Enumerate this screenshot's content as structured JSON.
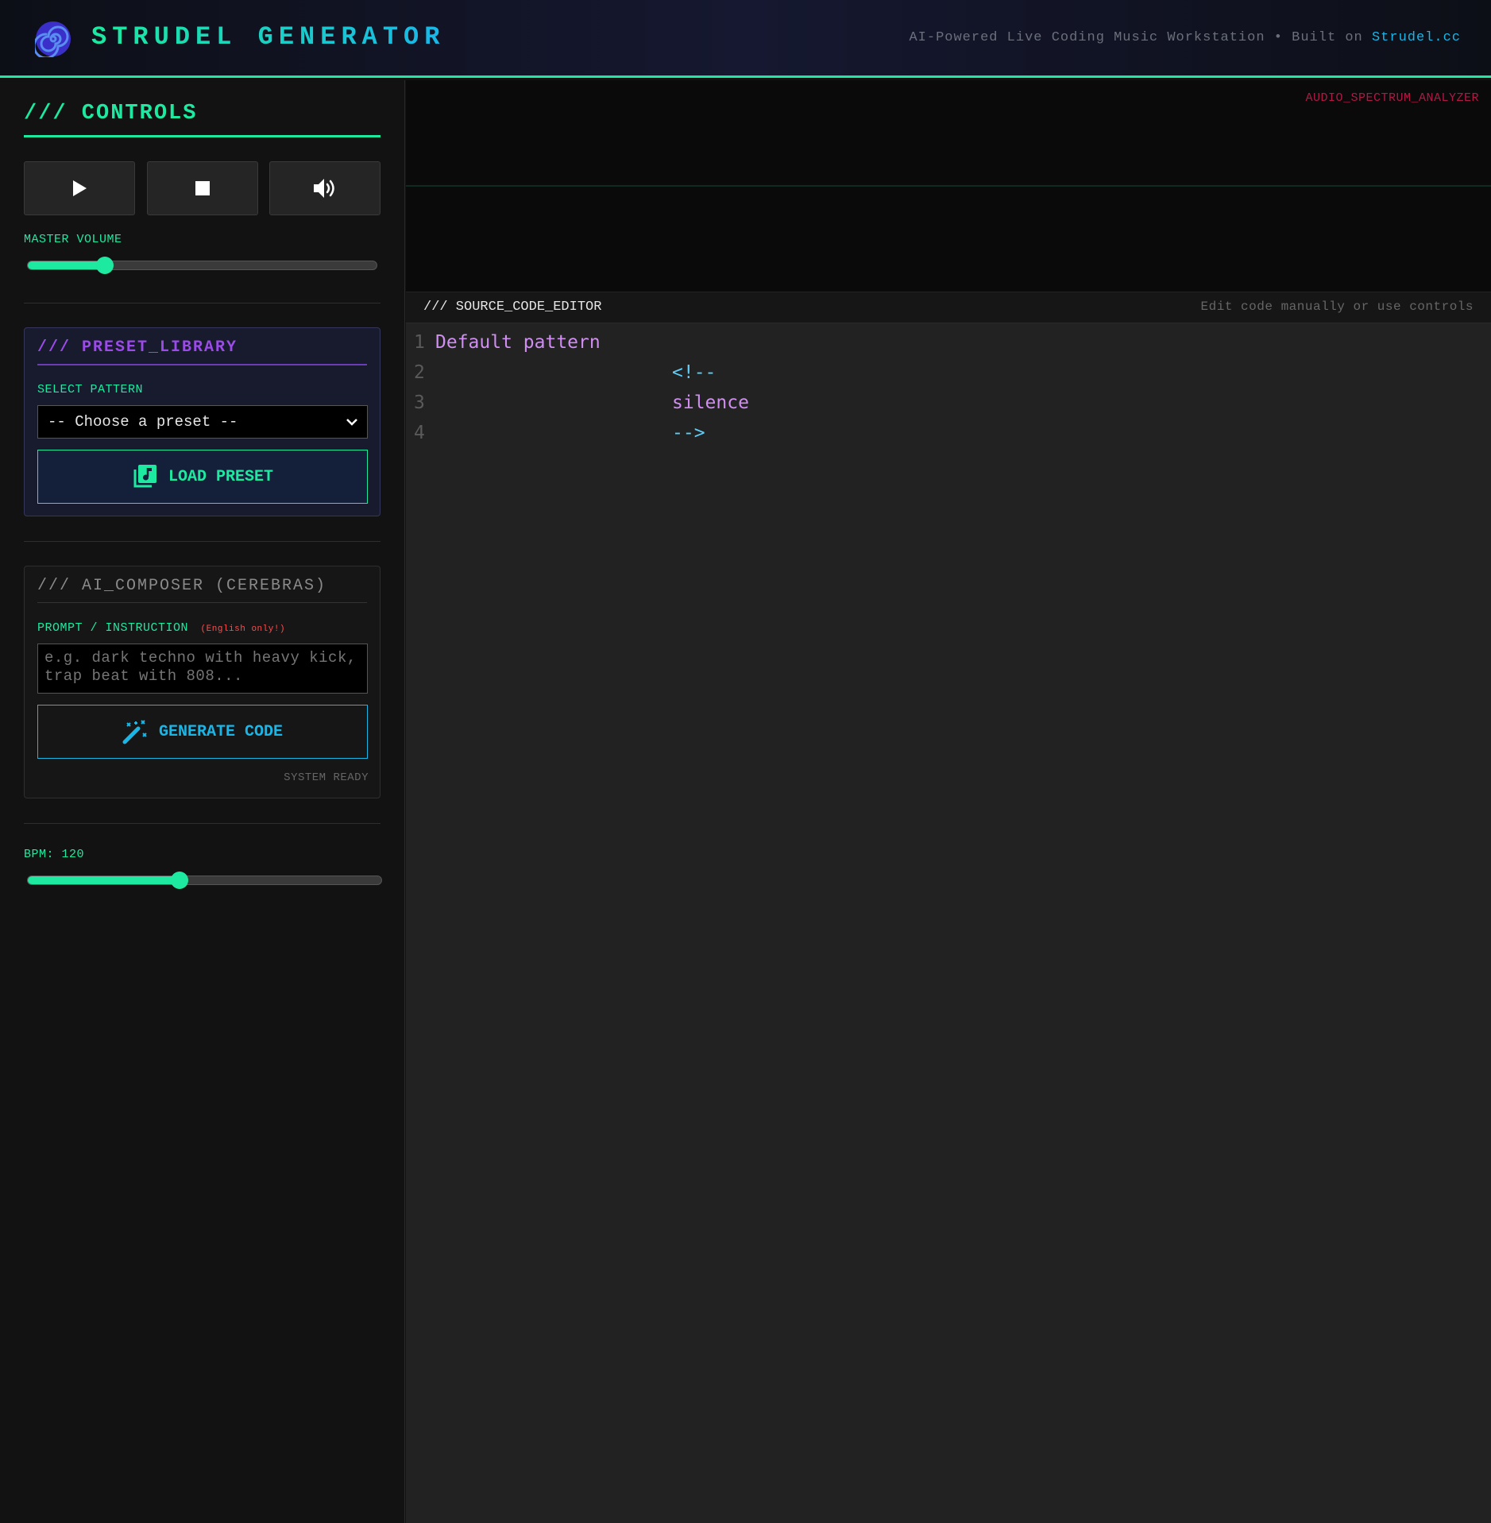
{
  "header": {
    "title": "STRUDEL GENERATOR",
    "tagline_prefix": "AI-Powered Live Coding Music Workstation • Built on ",
    "tagline_link": "Strudel.cc"
  },
  "controls": {
    "section_title": "/// CONTROLS",
    "volume_label": "MASTER VOLUME",
    "volume_level": 0.22,
    "bpm_label": "BPM: 120",
    "bpm_level": 0.43
  },
  "preset_library": {
    "title": "/// PRESET_LIBRARY",
    "select_label": "SELECT PATTERN",
    "select_value": "-- Choose a preset --",
    "load_button": "LOAD PRESET"
  },
  "ai_composer": {
    "title": "/// AI_COMPOSER (CEREBRAS)",
    "prompt_label": "PROMPT / INSTRUCTION",
    "prompt_note": "(English only!)",
    "prompt_placeholder": "e.g. dark techno with heavy kick, trap beat with 808...",
    "generate_button": "GENERATE CODE",
    "status": "SYSTEM READY"
  },
  "spectrum": {
    "label": "AUDIO_SPECTRUM_ANALYZER"
  },
  "editor": {
    "title": "/// SOURCE_CODE_EDITOR",
    "hint": "Edit code manually or use controls",
    "lines": [
      {
        "num": "1",
        "text": "Default pattern"
      },
      {
        "num": "2",
        "text": "<!--"
      },
      {
        "num": "3",
        "text": "silence"
      },
      {
        "num": "4",
        "text": "-->"
      }
    ]
  },
  "colors": {
    "accent_green": "#1de9a0",
    "accent_blue": "#19b6e8",
    "accent_purple": "#9b4be8",
    "code_purple": "#cf8ef0",
    "code_cyan": "#5ecdf7",
    "spectrum_label_red": "#b01845"
  },
  "icons": [
    "spiral-logo-icon",
    "play-icon",
    "stop-icon",
    "volume-icon",
    "chevron-down-icon",
    "music-library-icon",
    "magic-wand-icon",
    "resize-handle-icon"
  ]
}
